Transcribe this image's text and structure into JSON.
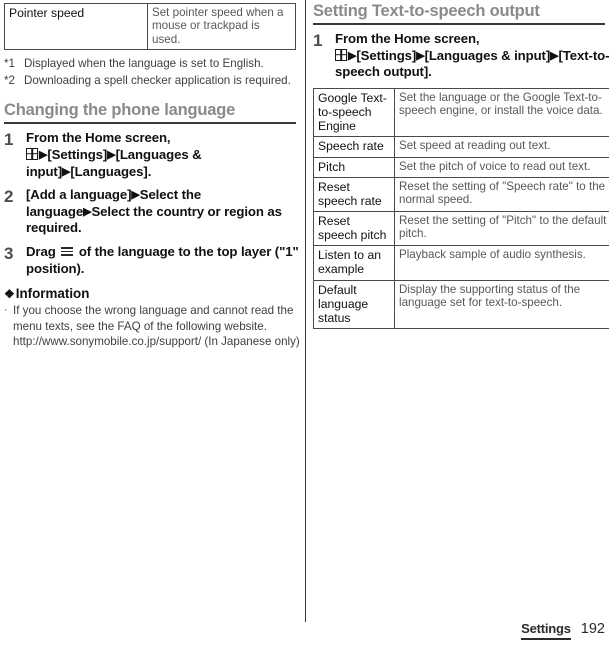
{
  "page": {
    "footer": {
      "section_label": "Settings",
      "page_number": "192"
    }
  },
  "left_column": {
    "continued_table": {
      "rows": [
        {
          "term": "Pointer speed",
          "description": "Set pointer speed when a mouse or trackpad is used."
        }
      ]
    },
    "footnotes": [
      {
        "mark": "*1",
        "text": "Displayed when the language is set to English."
      },
      {
        "mark": "*2",
        "text": "Downloading a spell checker application is required."
      }
    ],
    "section": {
      "heading": "Changing the phone language",
      "steps": [
        {
          "number": "1",
          "line1": "From the Home screen,",
          "part_after_grid": "[Settings]",
          "part_mid": "[Languages & input]",
          "part_end": "[Languages]."
        },
        {
          "number": "2",
          "seg1": "[Add a language]",
          "seg2": "Select the language",
          "seg3": "Select the country or region as required."
        },
        {
          "number": "3",
          "prefix": "Drag",
          "suffix": "of the language to the top layer (\"1\" position)."
        }
      ]
    },
    "information": {
      "glyph": "❖",
      "heading": "Information",
      "items": [
        {
          "bullet": "·",
          "text": "If you choose the wrong language and cannot read the menu texts, see the FAQ of the following website. http://www.sonymobile.co.jp/support/ (In Japanese only)"
        }
      ]
    }
  },
  "right_column": {
    "section": {
      "heading": "Setting Text-to-speech output",
      "steps": [
        {
          "number": "1",
          "line1": "From the Home screen,",
          "part_after_grid": "[Settings]",
          "part_mid": "[Languages & input]",
          "part_end": "[Text-to-speech output]."
        }
      ]
    },
    "settings_table": {
      "rows": [
        {
          "term": "Google Text-to-speech Engine",
          "description": "Set the language or the Google Text-to-speech engine, or install the voice data."
        },
        {
          "term": "Speech rate",
          "description": "Set speed at reading out text."
        },
        {
          "term": "Pitch",
          "description": "Set the pitch of voice to read out text."
        },
        {
          "term": "Reset speech rate",
          "description": "Reset the setting of \"Speech rate\" to the normal speed."
        },
        {
          "term": "Reset speech pitch",
          "description": "Reset the setting of \"Pitch\" to the default pitch."
        },
        {
          "term": "Listen to an example",
          "description": "Playback sample of audio synthesis."
        },
        {
          "term": "Default language status",
          "description": "Display the supporting status of the language set for text-to-speech."
        }
      ]
    }
  },
  "icons": {
    "app_drawer": "grid-icon",
    "drag_handle": "hamburger-icon",
    "step_arrow": "▶"
  }
}
